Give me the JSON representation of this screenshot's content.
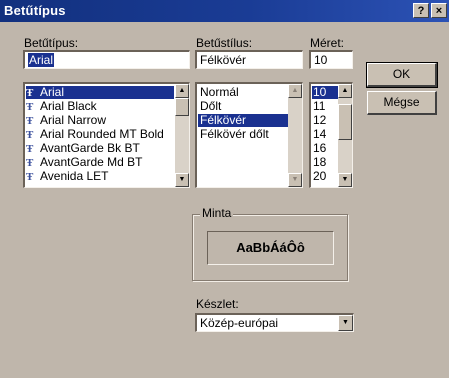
{
  "window": {
    "title": "Betűtípus",
    "help_label": "?",
    "close_label": "×"
  },
  "font": {
    "label": "Betűtípus:",
    "value": "Arial",
    "type_icon": "truetype-icon",
    "items": [
      "Arial",
      "Arial Black",
      "Arial Narrow",
      "Arial Rounded MT Bold",
      "AvantGarde Bk BT",
      "AvantGarde Md BT",
      "Avenida LET"
    ],
    "selected_index": 0
  },
  "style": {
    "label": "Betűstílus:",
    "value": "Félkövér",
    "items": [
      "Normál",
      "Dőlt",
      "Félkövér",
      "Félkövér dőlt"
    ],
    "selected_index": 2
  },
  "size": {
    "label": "Méret:",
    "value": "10",
    "items": [
      "10",
      "11",
      "12",
      "14",
      "16",
      "18",
      "20"
    ],
    "selected_index": 0
  },
  "buttons": {
    "ok_label": "OK",
    "cancel_label": "Mégse"
  },
  "sample": {
    "label": "Minta",
    "text": "AaBbÁáÔô"
  },
  "script": {
    "label": "Készlet:",
    "value": "Közép-európai"
  },
  "colors": {
    "titlebar": "#1a3c95",
    "selection": "#1a3190",
    "face": "#bfb6ab"
  }
}
